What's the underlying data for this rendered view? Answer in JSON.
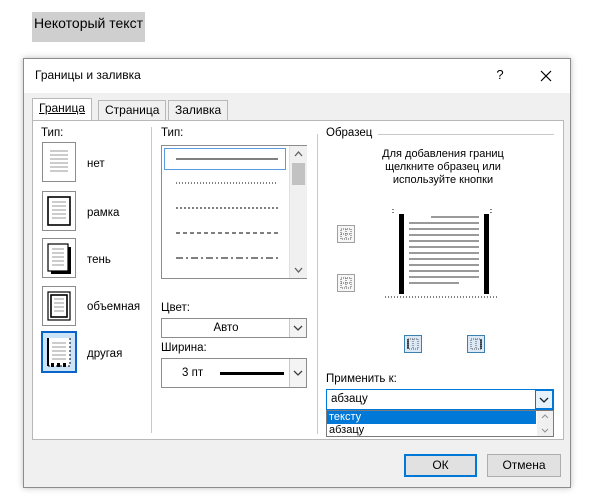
{
  "document": {
    "text": "Некоторый текст"
  },
  "dialog": {
    "title": "Границы и заливка",
    "help_glyph": "?",
    "tabs": [
      {
        "label": "Граница",
        "active": true
      },
      {
        "label": "Страница",
        "active": false
      },
      {
        "label": "Заливка",
        "active": false
      }
    ],
    "setting": {
      "heading": "Тип:",
      "options": [
        {
          "label": "нет",
          "selected": false
        },
        {
          "label": "рамка",
          "selected": false
        },
        {
          "label": "тень",
          "selected": false
        },
        {
          "label": "объемная",
          "selected": false
        },
        {
          "label": "другая",
          "selected": true
        }
      ]
    },
    "style": {
      "heading": "Тип:",
      "line_styles": [
        "solid",
        "dotted",
        "dashed-small",
        "dashed",
        "dash-dot"
      ],
      "selected_index": 0
    },
    "color": {
      "label": "Цвет:",
      "value": "Авто"
    },
    "width": {
      "label": "Ширина:",
      "value": "3 пт"
    },
    "preview": {
      "heading": "Образец",
      "instructions": [
        "Для добавления границ",
        "щелкните образец или",
        "используйте кнопки"
      ]
    },
    "apply_to": {
      "label": "Применить к:",
      "value": "абзацу",
      "options": [
        {
          "label": "тексту",
          "highlighted": true
        },
        {
          "label": "абзацу",
          "highlighted": false
        }
      ]
    },
    "buttons": {
      "ok": "ОК",
      "cancel": "Отмена"
    },
    "colors": {
      "accent": "#0078d7",
      "selection": "#0a64c8",
      "panel": "#ffffff",
      "frame": "#f0f0f0"
    }
  }
}
